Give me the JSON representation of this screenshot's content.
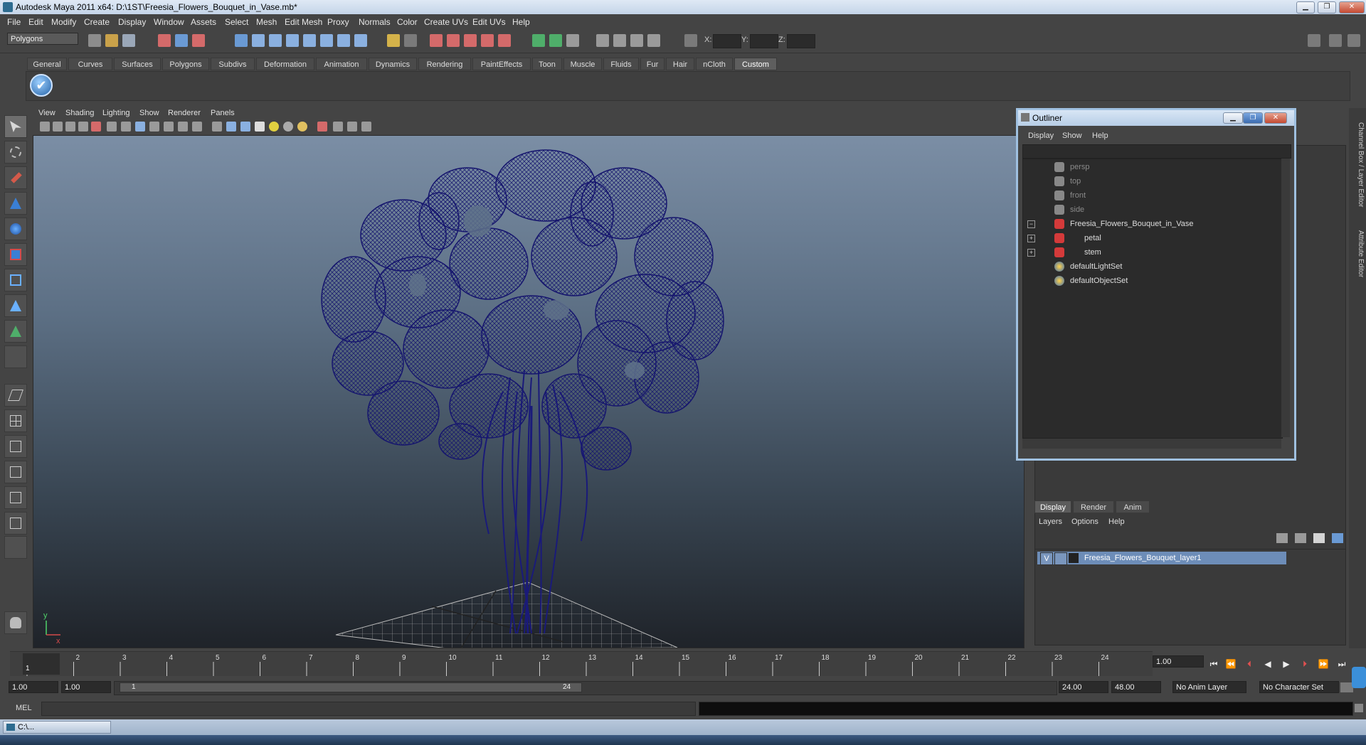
{
  "window": {
    "title": "Autodesk Maya 2011 x64: D:\\1ST\\Freesia_Flowers_Bouquet_in_Vase.mb*",
    "min_label": "▁",
    "max_label": "❐",
    "close_label": "✕"
  },
  "menubar": [
    "File",
    "Edit",
    "Modify",
    "Create",
    "Display",
    "Window",
    "Assets",
    "Select",
    "Mesh",
    "Edit Mesh",
    "Proxy",
    "Normals",
    "Color",
    "Create UVs",
    "Edit UVs",
    "Help"
  ],
  "toolbar": {
    "mode": "Polygons",
    "x_label": "X:",
    "y_label": "Y:",
    "z_label": "Z:"
  },
  "shelf": {
    "tabs": [
      "General",
      "Curves",
      "Surfaces",
      "Polygons",
      "Subdivs",
      "Deformation",
      "Animation",
      "Dynamics",
      "Rendering",
      "PaintEffects",
      "Toon",
      "Muscle",
      "Fluids",
      "Fur",
      "Hair",
      "nCloth",
      "Custom"
    ],
    "active_tab": "Custom",
    "check_glyph": "✔"
  },
  "viewport": {
    "menu": [
      "View",
      "Shading",
      "Lighting",
      "Show",
      "Renderer",
      "Panels"
    ],
    "axis_y": "y",
    "axis_x": "x",
    "wire_color": "#1a1a7a"
  },
  "outliner": {
    "title": "Outliner",
    "menu": [
      "Display",
      "Show",
      "Help"
    ],
    "items": [
      {
        "label": "persp",
        "dim": true,
        "indent": 0,
        "expander": ""
      },
      {
        "label": "top",
        "dim": true,
        "indent": 0,
        "expander": ""
      },
      {
        "label": "front",
        "dim": true,
        "indent": 0,
        "expander": ""
      },
      {
        "label": "side",
        "dim": true,
        "indent": 0,
        "expander": ""
      },
      {
        "label": "Freesia_Flowers_Bouquet_in_Vase",
        "dim": false,
        "indent": 0,
        "expander": "−"
      },
      {
        "label": "petal",
        "dim": false,
        "indent": 1,
        "expander": "+"
      },
      {
        "label": "stem",
        "dim": false,
        "indent": 1,
        "expander": "+"
      },
      {
        "label": "defaultLightSet",
        "dim": false,
        "indent": 0,
        "expander": ""
      },
      {
        "label": "defaultObjectSet",
        "dim": false,
        "indent": 0,
        "expander": ""
      }
    ]
  },
  "side_tabs": [
    "Channel Box / Layer Editor",
    "Attribute Editor"
  ],
  "layer_editor": {
    "tabs": [
      "Display",
      "Render",
      "Anim"
    ],
    "active_tab": "Display",
    "menu": [
      "Layers",
      "Options",
      "Help"
    ],
    "layer_visibility": "V",
    "layer_name": "Freesia_Flowers_Bouquet_layer1"
  },
  "timeline": {
    "ticks": [
      "1",
      "2",
      "3",
      "4",
      "5",
      "6",
      "7",
      "8",
      "9",
      "10",
      "11",
      "12",
      "13",
      "14",
      "15",
      "16",
      "17",
      "18",
      "19",
      "20",
      "21",
      "22",
      "23",
      "24"
    ],
    "current_frame_marker": "1",
    "current_time": "1.00",
    "range_start": "1.00",
    "range_start2": "1.00",
    "slider_start": "1",
    "slider_end": "24",
    "end_time": "24.00",
    "end_time2": "48.00",
    "anim_layer": "No Anim Layer",
    "character_set": "No Character Set",
    "playback_glyphs": [
      "⏮",
      "⏪",
      "⏴",
      "◀",
      "▶",
      "⏵",
      "⏩",
      "⏭"
    ]
  },
  "command_line": {
    "label": "MEL"
  },
  "taskbar": {
    "item": "C:\\..."
  }
}
